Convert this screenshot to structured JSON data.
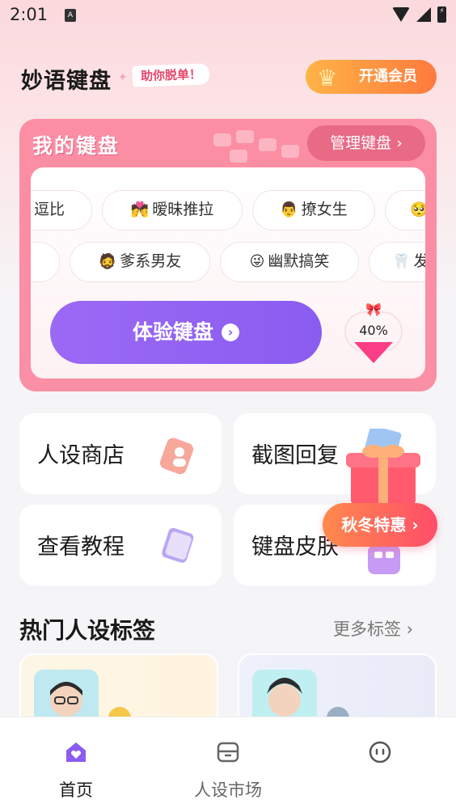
{
  "status_bar": {
    "time": "2:01",
    "notification_icon": "A"
  },
  "header": {
    "app_title": "妙语键盘",
    "slogan": "助你脱单！",
    "vip_button": "开通会员"
  },
  "my_keyboard": {
    "title": "我的键盘",
    "manage_button": "管理键盘 ›",
    "tags_row1": [
      {
        "label": "逗比",
        "emoji": ""
      },
      {
        "label": "暧昧推拉",
        "emoji": "💏"
      },
      {
        "label": "撩女生",
        "emoji": "👨"
      },
      {
        "label": "",
        "emoji": "🥺"
      }
    ],
    "tags_row2": [
      {
        "label": "",
        "emoji": ""
      },
      {
        "label": "爹系男友",
        "emoji": "🧔"
      },
      {
        "label": "幽默搞笑",
        "emoji": "😜"
      },
      {
        "label": "发",
        "emoji": "🦷"
      }
    ],
    "try_button": "体验键盘",
    "progress_percent": "40%",
    "progress_value": 0.4
  },
  "features": [
    {
      "label": "人设商店",
      "icon": "tag-icon"
    },
    {
      "label": "截图回复",
      "icon": "photo-icon"
    },
    {
      "label": "查看教程",
      "icon": "book-icon"
    },
    {
      "label": "键盘皮肤",
      "icon": "keyboard-icon"
    }
  ],
  "promo": {
    "label": "秋冬特惠 ›",
    "icon": "gift-icon"
  },
  "hot_tags": {
    "title": "热门人设标签",
    "more": "更多标签 ›"
  },
  "bottom_nav": [
    {
      "label": "首页",
      "icon": "home-heart-icon",
      "active": true
    },
    {
      "label": "人设市场",
      "icon": "store-icon",
      "active": false
    },
    {
      "label": "",
      "icon": "chat-face-icon",
      "active": false
    }
  ],
  "colors": {
    "accent_purple": "#8a5cf0",
    "card_pink": "#fa8fa5",
    "vip_orange": "#ff7a3d",
    "promo_red": "#ff4d6a"
  }
}
